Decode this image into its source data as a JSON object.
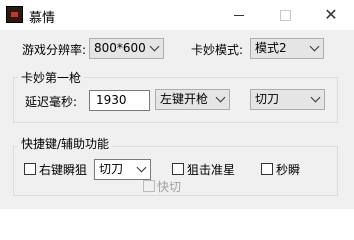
{
  "window": {
    "title": "慕情"
  },
  "resolution": {
    "label": "游戏分辨率:",
    "value": "800*600"
  },
  "mode": {
    "label": "卡妙模式:",
    "value": "模式2"
  },
  "group1": {
    "title": "卡妙第一枪",
    "delay_label": "延迟毫秒:",
    "delay_value": "1930",
    "trigger_value": "左键开枪",
    "action_value": "切刀"
  },
  "group2": {
    "title": "快捷键/辅助功能",
    "right_snipe_label": "右键瞬狙",
    "right_snipe_action": "切刀",
    "sniper_crosshair_label": "狙击准星",
    "instant_scope_label": "秒瞬",
    "quick_cut_label": "快切"
  }
}
